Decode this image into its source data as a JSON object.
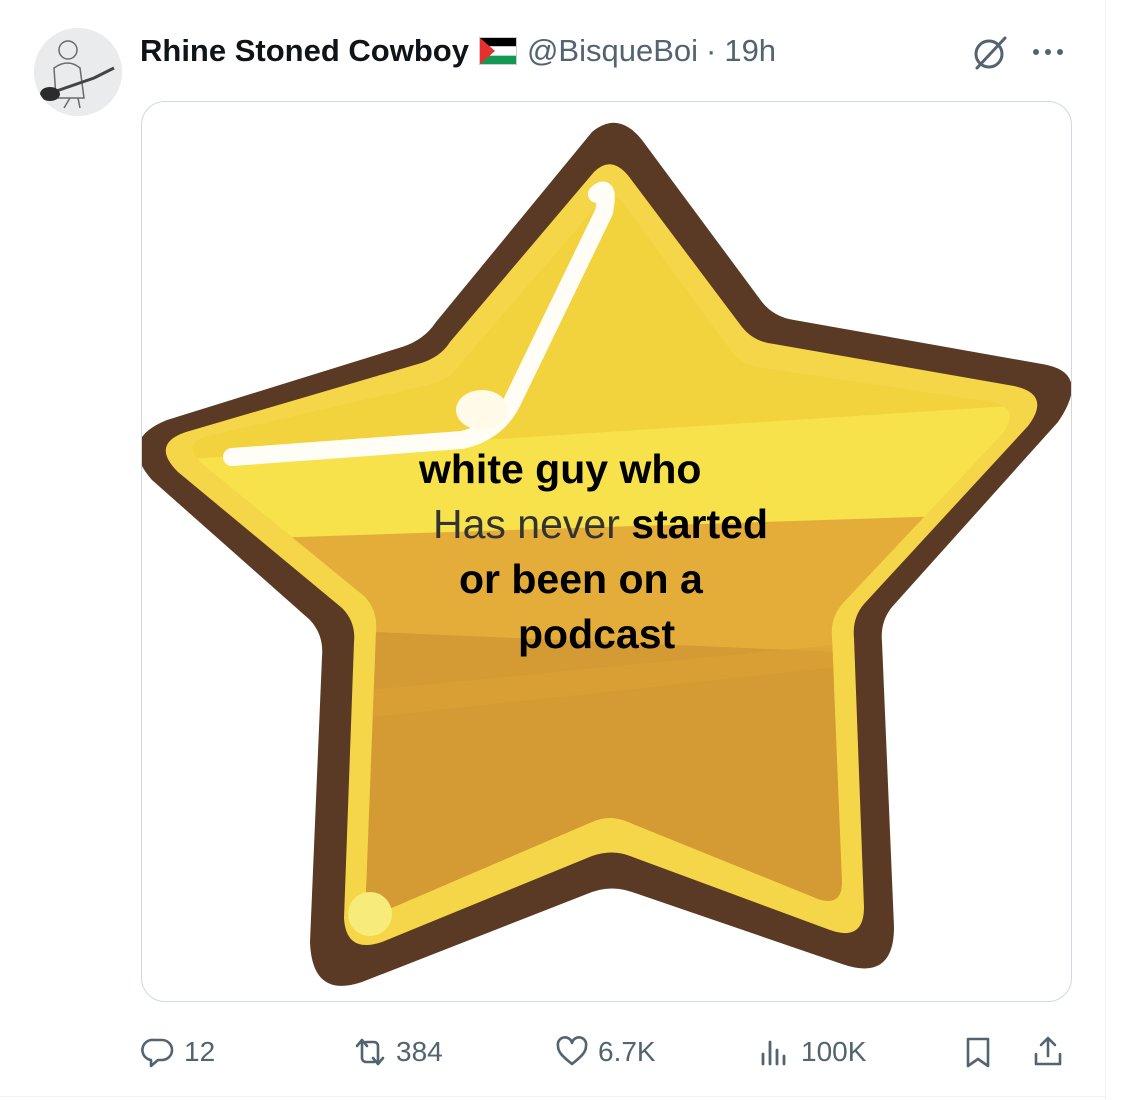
{
  "post": {
    "author": {
      "display_name": "Rhine Stoned Cowboy",
      "handle": "@BisqueBoi",
      "separator": "·",
      "time": "19h",
      "flag_colors": [
        "#000000",
        "#ffffff",
        "#149954",
        "#e4312b"
      ]
    },
    "media": {
      "caption_lines": [
        "white guy who",
        "Has never",
        "started",
        "or been on a",
        "podcast"
      ],
      "colors": {
        "outline": "#5a3a24",
        "gold_light": "#f2d23d",
        "gold_mid": "#e4ad3a",
        "gold_dark": "#d49a33"
      }
    },
    "actions": {
      "replies": "12",
      "reposts": "384",
      "likes": "6.7K",
      "views": "100K"
    },
    "icons": [
      "grok-icon",
      "more-icon",
      "reply-icon",
      "repost-icon",
      "like-icon",
      "views-icon",
      "bookmark-icon",
      "share-icon"
    ]
  }
}
